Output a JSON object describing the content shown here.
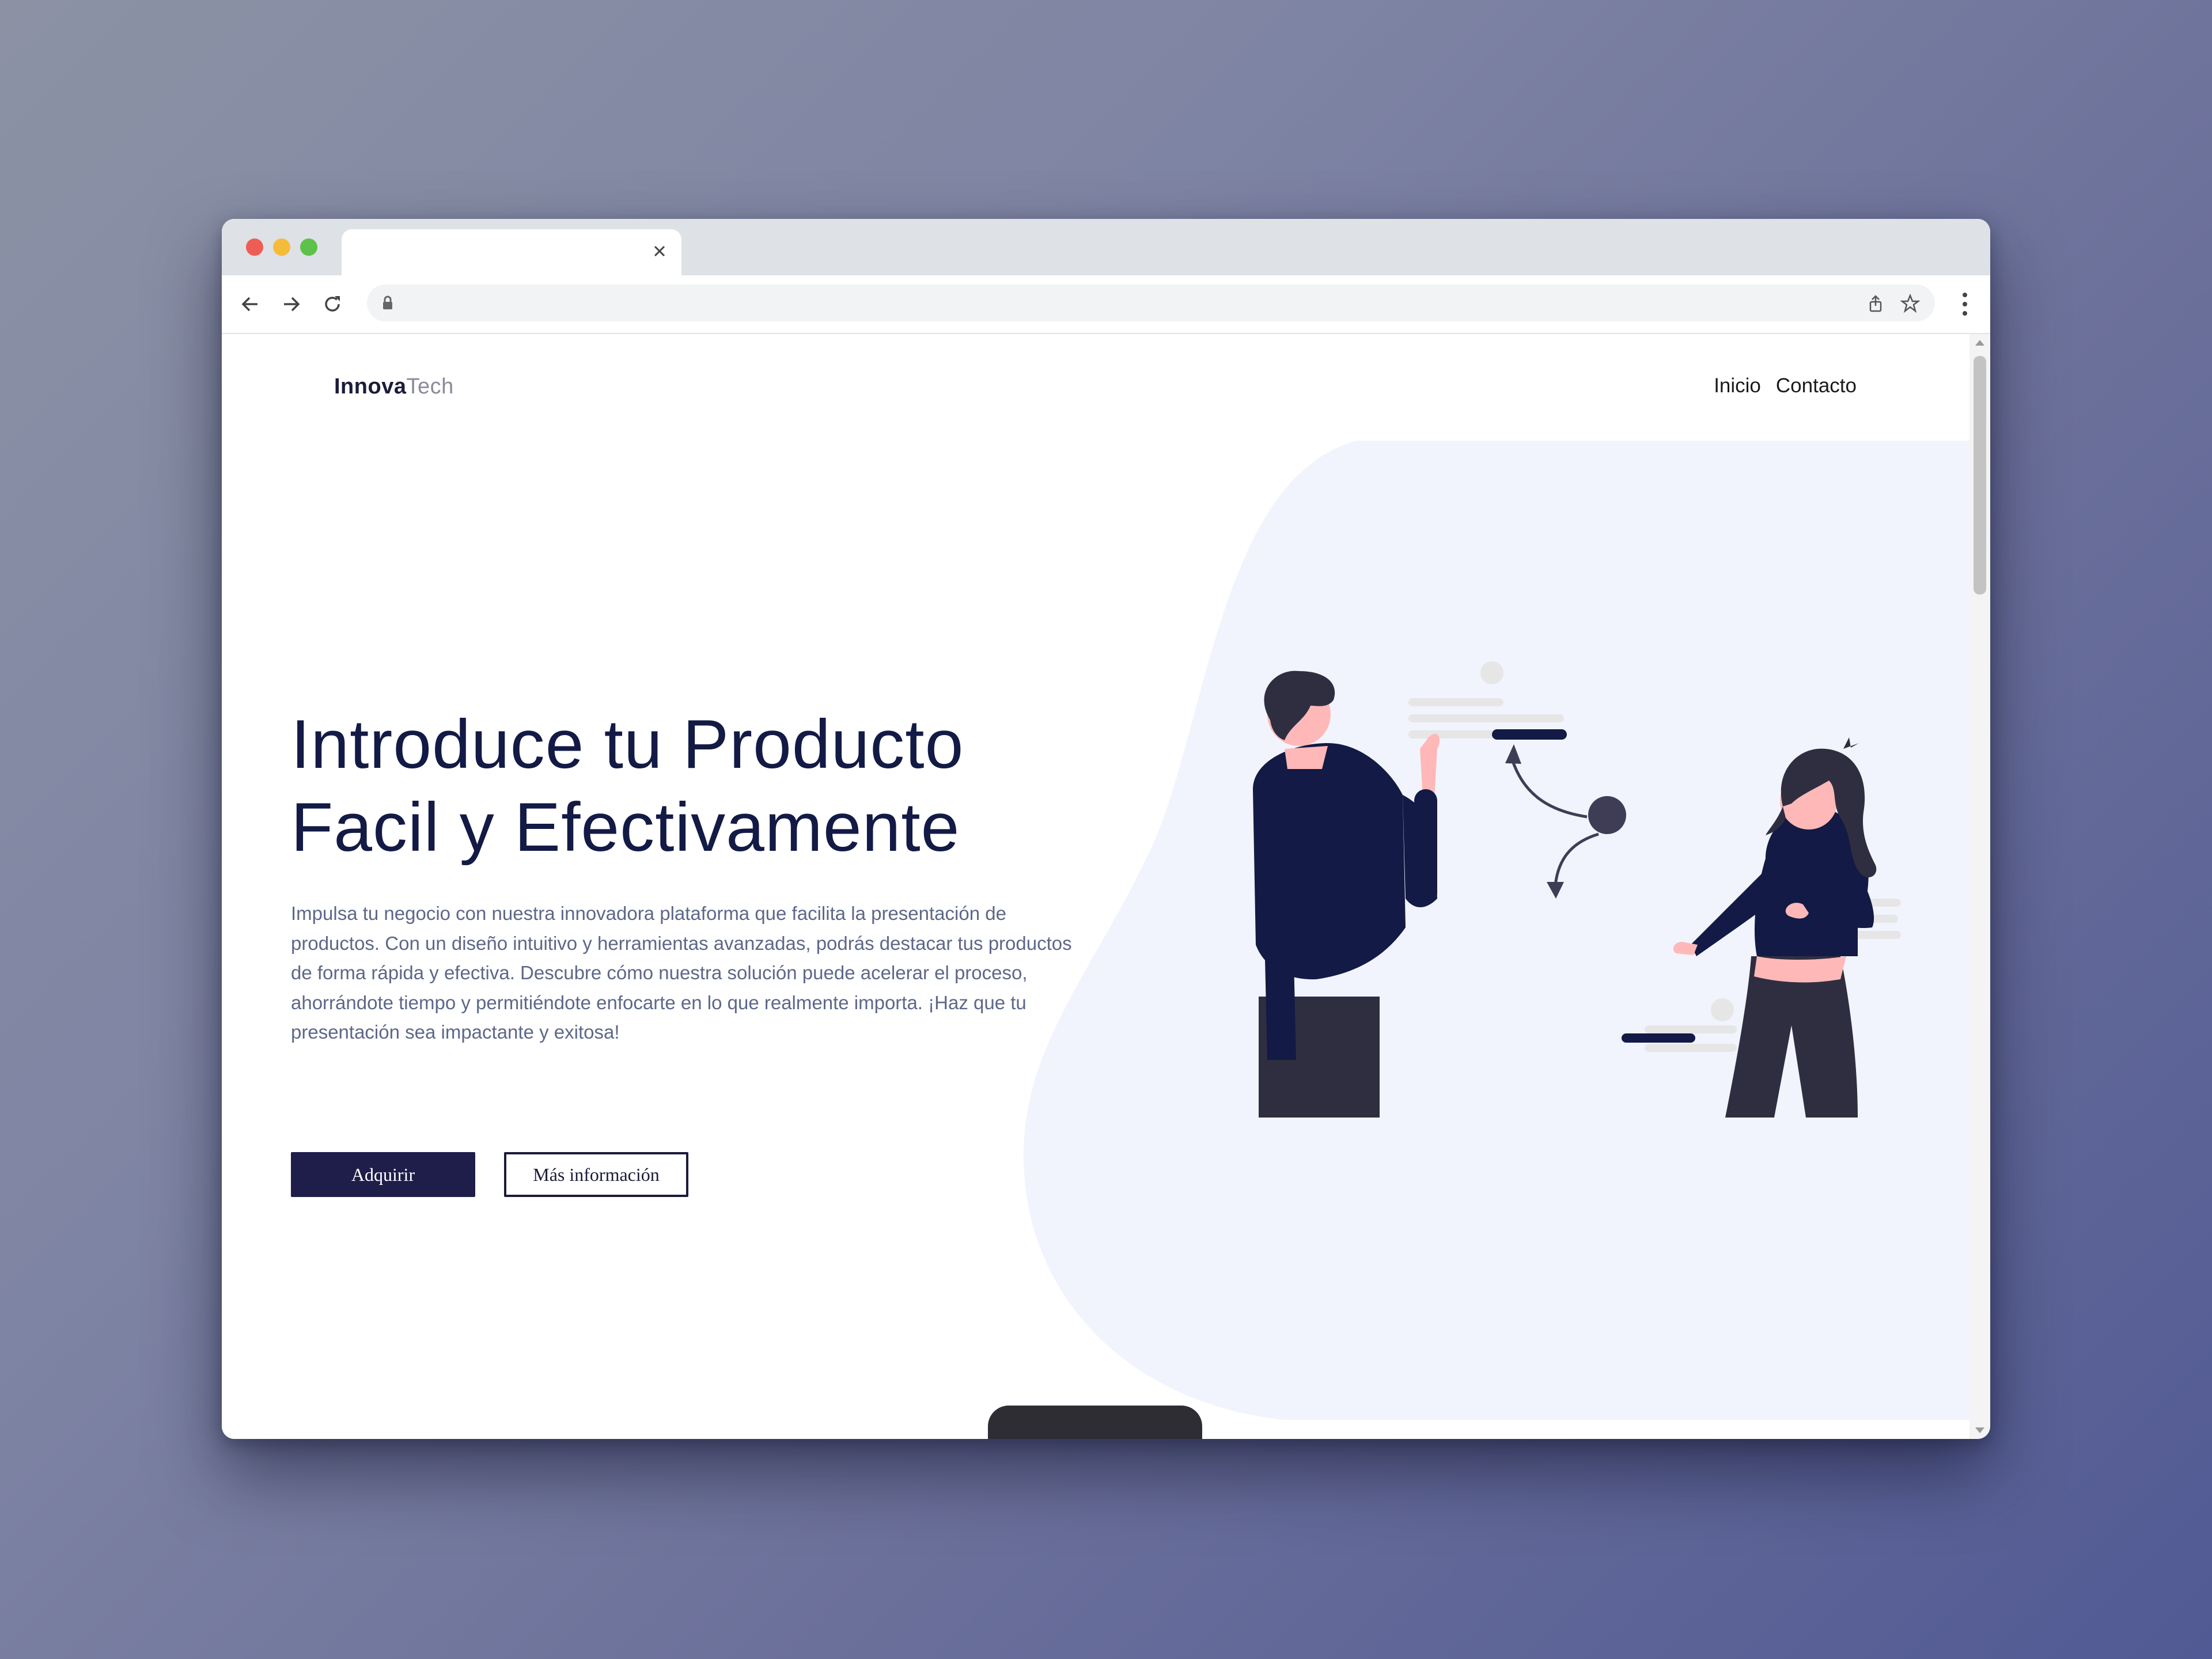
{
  "browser": {
    "tab_title": "",
    "url": ""
  },
  "site": {
    "brand_bold": "Innova",
    "brand_light": "Tech",
    "nav": [
      "Inicio",
      "Contacto"
    ]
  },
  "hero": {
    "title_line1": "Introduce tu Producto",
    "title_line2": "Facil y Efectivamente",
    "description": "Impulsa tu negocio con nuestra innovadora plataforma que facilita la presentación de productos. Con un diseño intuitivo y herramientas avanzadas, podrás destacar tus productos de forma rápida y efectiva. Descubre cómo nuestra solución puede acelerar el proceso, ahorrándote tiempo y permitiéndote enfocarte en lo que realmente importa. ¡Haz que tu presentación sea impactante y exitosa!",
    "primary_button": "Adquirir",
    "secondary_button": "Más información"
  },
  "colors": {
    "navy": "#121a45",
    "button_dark": "#1f1d4a",
    "blob": "#f1f4fd",
    "body_text": "#5d6788"
  },
  "icons": [
    "back-arrow-icon",
    "forward-arrow-icon",
    "reload-icon",
    "lock-icon",
    "share-icon",
    "star-icon",
    "more-vert-icon",
    "close-icon"
  ]
}
